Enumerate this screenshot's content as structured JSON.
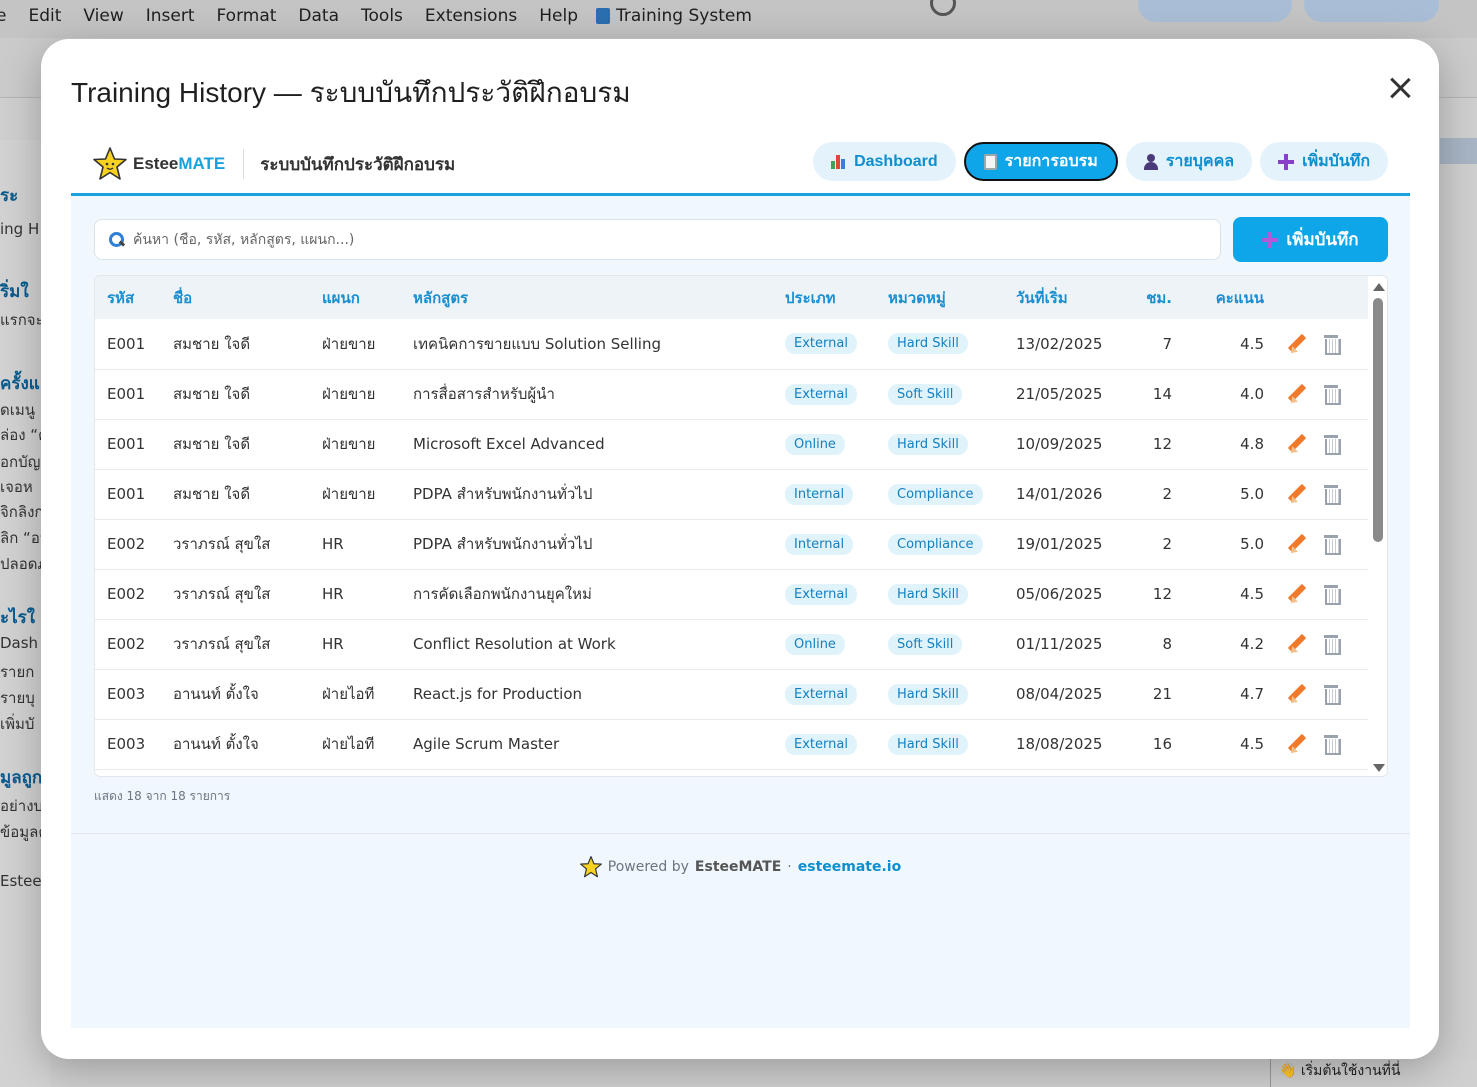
{
  "background": {
    "menu": [
      "e",
      "Edit",
      "View",
      "Insert",
      "Format",
      "Data",
      "Tools",
      "Extensions",
      "Help"
    ],
    "doc_title": "Training System",
    "side_texts": [
      "ระ",
      "ing H",
      "ริ่มใ",
      "แรกจะ",
      "ครั้งแ",
      "ดเมนู",
      "ล่อง “ต",
      "อกบัญ",
      "เจอห",
      "จิกลิงก",
      "ลิก “อน",
      "ปลอดภ",
      "ะไรใ",
      "Dash",
      "รายก",
      "รายบุ",
      "เพิ่มบั",
      "มูลถูก",
      "อย่างบ",
      "ข้อมูลต",
      "EsteeM"
    ],
    "bottom_tip": "👋 เริ่มต้นใช้งานที่นี่"
  },
  "modal": {
    "title": "Training History — ระบบบันทึกประวัติฝึกอบรม"
  },
  "app": {
    "brand_prefix": "Estee",
    "brand_suffix": "MATE",
    "subtitle": "ระบบบันทึกประวัติฝึกอบรม",
    "nav": [
      {
        "label": "Dashboard",
        "icon": "bar-chart-icon"
      },
      {
        "label": "รายการอบรม",
        "icon": "clipboard-icon",
        "active": true
      },
      {
        "label": "รายบุคคล",
        "icon": "person-icon"
      },
      {
        "label": "เพิ่มบันทึก",
        "icon": "plus-icon"
      }
    ],
    "search_placeholder": "ค้นหา (ชื่อ, รหัส, หลักสูตร, แผนก...)",
    "add_button": "เพิ่มบันทึก",
    "columns": [
      "รหัส",
      "ชื่อ",
      "แผนก",
      "หลักสูตร",
      "ประเภท",
      "หมวดหมู่",
      "วันที่เริ่ม",
      "ชม.",
      "คะแนน"
    ],
    "rows": [
      {
        "id": "E001",
        "name": "สมชาย ใจดี",
        "dept": "ฝ่ายขาย",
        "course": "เทคนิคการขายแบบ Solution Selling",
        "type": "External",
        "category": "Hard Skill",
        "start": "13/02/2025",
        "hours": "7",
        "score": "4.5"
      },
      {
        "id": "E001",
        "name": "สมชาย ใจดี",
        "dept": "ฝ่ายขาย",
        "course": "การสื่อสารสำหรับผู้นำ",
        "type": "External",
        "category": "Soft Skill",
        "start": "21/05/2025",
        "hours": "14",
        "score": "4.0"
      },
      {
        "id": "E001",
        "name": "สมชาย ใจดี",
        "dept": "ฝ่ายขาย",
        "course": "Microsoft Excel Advanced",
        "type": "Online",
        "category": "Hard Skill",
        "start": "10/09/2025",
        "hours": "12",
        "score": "4.8"
      },
      {
        "id": "E001",
        "name": "สมชาย ใจดี",
        "dept": "ฝ่ายขาย",
        "course": "PDPA สำหรับพนักงานทั่วไป",
        "type": "Internal",
        "category": "Compliance",
        "start": "14/01/2026",
        "hours": "2",
        "score": "5.0"
      },
      {
        "id": "E002",
        "name": "วราภรณ์ สุขใส",
        "dept": "HR",
        "course": "PDPA สำหรับพนักงานทั่วไป",
        "type": "Internal",
        "category": "Compliance",
        "start": "19/01/2025",
        "hours": "2",
        "score": "5.0"
      },
      {
        "id": "E002",
        "name": "วราภรณ์ สุขใส",
        "dept": "HR",
        "course": "การคัดเลือกพนักงานยุคใหม่",
        "type": "External",
        "category": "Hard Skill",
        "start": "05/06/2025",
        "hours": "12",
        "score": "4.5"
      },
      {
        "id": "E002",
        "name": "วราภรณ์ สุขใส",
        "dept": "HR",
        "course": "Conflict Resolution at Work",
        "type": "Online",
        "category": "Soft Skill",
        "start": "01/11/2025",
        "hours": "8",
        "score": "4.2"
      },
      {
        "id": "E003",
        "name": "อานนท์ ตั้งใจ",
        "dept": "ฝ่ายไอที",
        "course": "React.js for Production",
        "type": "External",
        "category": "Hard Skill",
        "start": "08/04/2025",
        "hours": "21",
        "score": "4.7"
      },
      {
        "id": "E003",
        "name": "อานนท์ ตั้งใจ",
        "dept": "ฝ่ายไอที",
        "course": "Agile Scrum Master",
        "type": "External",
        "category": "Hard Skill",
        "start": "18/08/2025",
        "hours": "16",
        "score": "4.5"
      }
    ],
    "count_text": "แสดง 18 จาก 18 รายการ",
    "footer": {
      "powered": "Powered by",
      "brand": "EsteeMATE",
      "dot": "·",
      "link": "esteemate.io"
    }
  },
  "colors": {
    "accent": "#0ea5e9",
    "header_text": "#1a8fd0",
    "badge_bg": "#e0f3fb"
  }
}
